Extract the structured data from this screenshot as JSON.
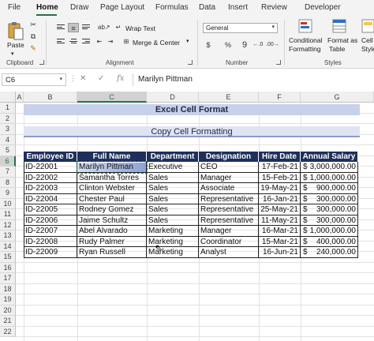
{
  "ribbon": {
    "tabs": [
      "File",
      "Home",
      "Draw",
      "Page Layout",
      "Formulas",
      "Data",
      "Insert",
      "Review",
      "Developer"
    ],
    "active_tab": "Home",
    "clipboard": {
      "paste_label": "Paste",
      "group_label": "Clipboard"
    },
    "alignment": {
      "wrap_text": "Wrap Text",
      "merge_center": "Merge & Center",
      "group_label": "Alignment"
    },
    "number": {
      "format": "General",
      "group_label": "Number"
    },
    "styles": {
      "conditional": "Conditional",
      "conditional2": "Formatting",
      "format_as": "Format as",
      "format_as2": "Table",
      "cell": "Cell",
      "cell2": "Styles",
      "group_label": "Styles"
    }
  },
  "formula_bar": {
    "name_box": "C6",
    "fx": "fx",
    "value": "Marilyn Pittman"
  },
  "sheet": {
    "columns": [
      "A",
      "B",
      "C",
      "D",
      "E",
      "F",
      "G"
    ],
    "rows": [
      "1",
      "2",
      "3",
      "4",
      "5",
      "6",
      "7",
      "8",
      "9",
      "10",
      "11",
      "12",
      "13",
      "14",
      "15",
      "16",
      "17",
      "18",
      "19",
      "20",
      "21",
      "22"
    ],
    "title": "Excel Cell Format",
    "subtitle": "Copy Cell Formatting",
    "headers": [
      "Employee ID",
      "Full Name",
      "Department",
      "Designation",
      "Hire Date",
      "Annual Salary"
    ],
    "data": [
      [
        "ID-22001",
        "Marilyn Pittman",
        "Executive",
        "CEO",
        "17-Feb-21",
        "$",
        "3,000,000.00"
      ],
      [
        "ID-22002",
        "Samantha Torres",
        "Sales",
        "Manager",
        "15-Feb-21",
        "$",
        "1,000,000.00"
      ],
      [
        "ID-22003",
        "Clinton Webster",
        "Sales",
        "Associate",
        "19-May-21",
        "$",
        "900,000.00"
      ],
      [
        "ID-22004",
        "Chester Paul",
        "Sales",
        "Representative",
        "16-Jan-21",
        "$",
        "300,000.00"
      ],
      [
        "ID-22005",
        "Rodney Gomez",
        "Sales",
        "Representative",
        "25-May-21",
        "$",
        "300,000.00"
      ],
      [
        "ID-22006",
        "Jaime Schultz",
        "Sales",
        "Representative",
        "11-May-21",
        "$",
        "300,000.00"
      ],
      [
        "ID-22007",
        "Abel Alvarado",
        "Marketing",
        "Manager",
        "16-Mar-21",
        "$",
        "1,000,000.00"
      ],
      [
        "ID-22008",
        "Rudy Palmer",
        "Marketing",
        "Coordinator",
        "15-Mar-21",
        "$",
        "400,000.00"
      ],
      [
        "ID-22009",
        "Ryan Russell",
        "Marketing",
        "Analyst",
        "16-Jun-21",
        "$",
        "240,000.00"
      ]
    ],
    "selected_cell": "C6",
    "colors": {
      "header_bg": "#1f2f5c",
      "title_bg": "#c8d1eb",
      "accent": "#217346"
    }
  }
}
